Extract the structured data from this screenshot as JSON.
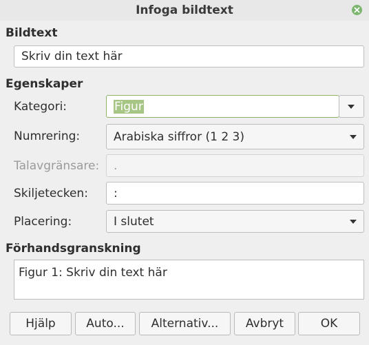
{
  "window": {
    "title": "Infoga bildtext"
  },
  "caption_section": {
    "title": "Bildtext",
    "text_value": "Skriv din text här"
  },
  "properties": {
    "title": "Egenskaper",
    "category_label": "Kategori:",
    "category_value": "Figur",
    "numbering_label": "Numrering:",
    "numbering_value": "Arabiska siffror (1 2 3)",
    "separator_label": "Talavgränsare:",
    "separator_value": ".",
    "punctuation_label": "Skiljetecken:",
    "punctuation_value": ":",
    "position_label": "Placering:",
    "position_value": "I slutet"
  },
  "preview": {
    "title": "Förhandsgranskning",
    "text": "Figur 1: Skriv din text här"
  },
  "buttons": {
    "help": "Hjälp",
    "auto": "Auto...",
    "options": "Alternativ...",
    "cancel": "Avbryt",
    "ok": "OK"
  },
  "icons": {
    "close": "close-icon"
  },
  "colors": {
    "selection": "#a7c585",
    "close_button": "#7cb66f"
  }
}
